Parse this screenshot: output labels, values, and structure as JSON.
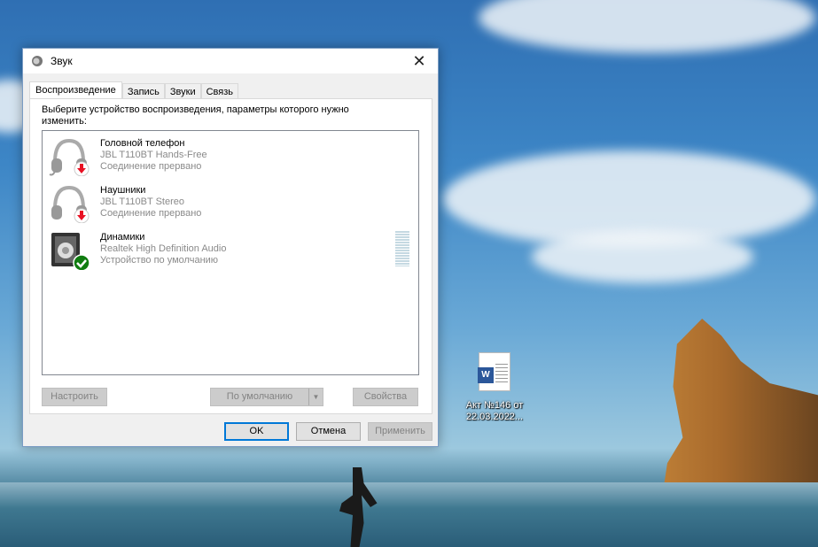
{
  "dialog": {
    "title": "Звук",
    "close_glyph": "✕",
    "tabs": [
      {
        "label": "Воспроизведение",
        "active": true
      },
      {
        "label": "Запись"
      },
      {
        "label": "Звуки"
      },
      {
        "label": "Связь"
      }
    ],
    "prompt": "Выберите устройство воспроизведения, параметры которого нужно изменить:",
    "devices": [
      {
        "name": "Головной телефон",
        "model": "JBL T110BT Hands-Free",
        "status": "Соединение прервано",
        "icon": "headset-icon",
        "badge": "disconnected"
      },
      {
        "name": "Наушники",
        "model": "JBL T110BT Stereo",
        "status": "Соединение прервано",
        "icon": "headphones-icon",
        "badge": "disconnected"
      },
      {
        "name": "Динамики",
        "model": "Realtek High Definition Audio",
        "status": "Устройство по умолчанию",
        "icon": "speaker-icon",
        "badge": "default"
      }
    ],
    "buttons": {
      "configure": "Настроить",
      "set_default": "По умолчанию",
      "properties": "Свойства",
      "ok": "OK",
      "cancel": "Отмена",
      "apply": "Применить"
    }
  },
  "desktop": {
    "icon_label": "Акт №146 от 22.03.2022...",
    "icon_letter": "W"
  },
  "colors": {
    "accent": "#0078d7",
    "disconnected": "#e81123",
    "ok": "#107c10"
  }
}
